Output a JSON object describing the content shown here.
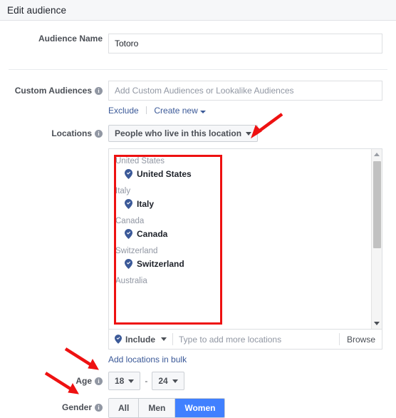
{
  "header": {
    "title": "Edit audience"
  },
  "colors": {
    "accent_blue": "#4080ff",
    "link_blue": "#3b5998",
    "annotation_red": "#ee1111",
    "pin_blue": "#3b5998",
    "label_gray": "#4b4f56"
  },
  "fields": {
    "audience_name": {
      "label": "Audience Name",
      "value": "Totoro"
    },
    "custom_audiences": {
      "label": "Custom Audiences",
      "placeholder": "Add Custom Audiences or Lookalike Audiences",
      "value": "",
      "exclude_link": "Exclude",
      "create_new_link": "Create new"
    },
    "locations": {
      "label": "Locations",
      "scope_dropdown": "People who live in this location",
      "groups": [
        {
          "group": "United States",
          "items": [
            {
              "name": "United States"
            }
          ]
        },
        {
          "group": "Italy",
          "items": [
            {
              "name": "Italy"
            }
          ]
        },
        {
          "group": "Canada",
          "items": [
            {
              "name": "Canada"
            }
          ]
        },
        {
          "group": "Switzerland",
          "items": [
            {
              "name": "Switzerland"
            }
          ]
        },
        {
          "group": "Australia",
          "items": []
        }
      ],
      "include_dropdown": "Include",
      "search_placeholder": "Type to add more locations",
      "search_value": "",
      "browse_button": "Browse",
      "bulk_link": "Add locations in bulk"
    },
    "age": {
      "label": "Age",
      "min": "18",
      "max": "24",
      "separator": "-"
    },
    "gender": {
      "label": "Gender",
      "options": [
        "All",
        "Men",
        "Women"
      ],
      "selected": "Women"
    }
  },
  "icons": {
    "info": "i",
    "location_pin": "location-pin-icon",
    "caret_down": "chevron-down-icon",
    "scroll_up": "scroll-up-arrow-icon",
    "scroll_down": "scroll-down-arrow-icon"
  }
}
